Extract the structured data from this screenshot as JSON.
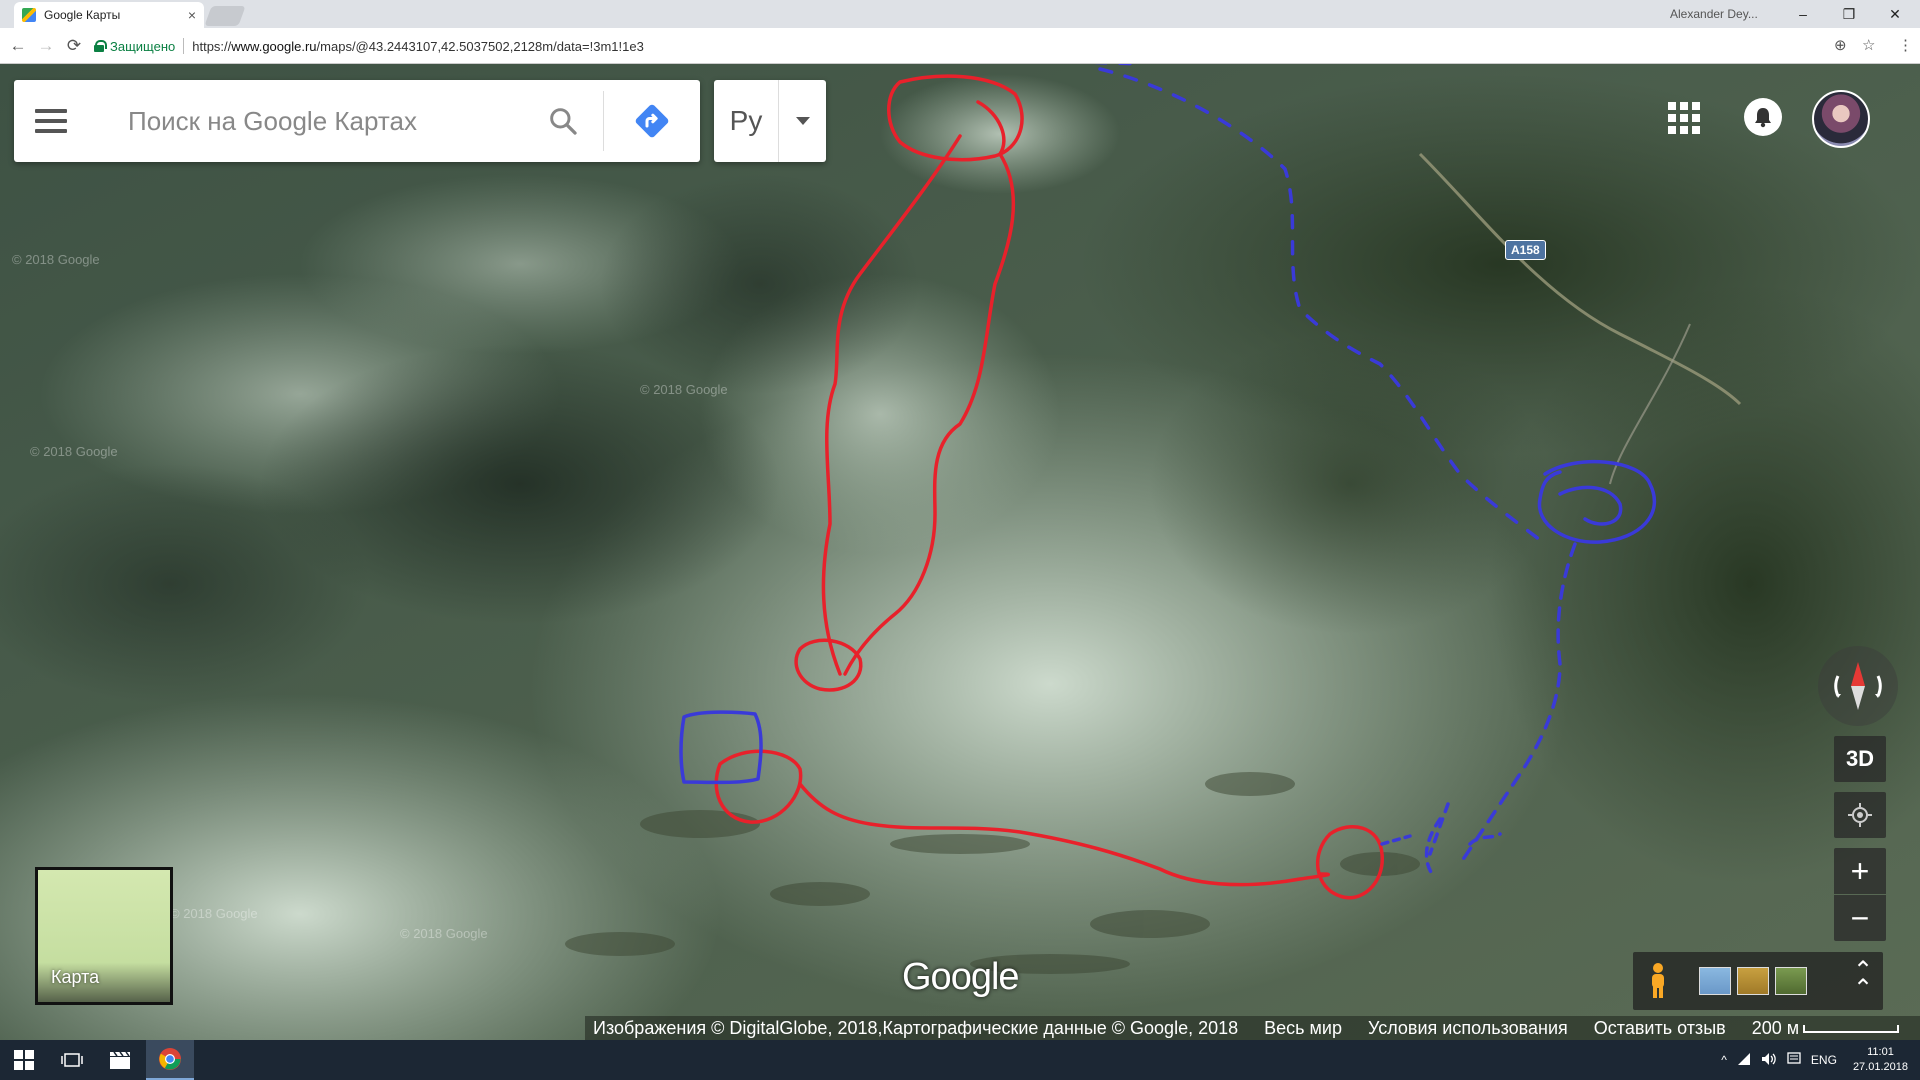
{
  "browser": {
    "tab_title": "Google Карты",
    "tab_close": "×",
    "profile_name": "Alexander Dey...",
    "window_min": "–",
    "window_max": "❐",
    "window_close": "✕",
    "back": "←",
    "forward": "→",
    "reload": "⟳",
    "secure_label": "Защищено",
    "url_scheme": "https://",
    "url_host": "www.google.ru",
    "url_path": "/maps/@43.2443107,42.5037502,2128m/data=!3m1!1e3",
    "zoom_icon": "⊕",
    "star_icon": "☆",
    "menu_icon": "⋮"
  },
  "search": {
    "placeholder": "Поиск на Google Картах"
  },
  "language": {
    "label": "Ру"
  },
  "map": {
    "road_label": "A158",
    "watermark": "© 2018 Google",
    "logo": "Google",
    "layer_label": "Карта",
    "btn_3d": "3D",
    "zoom_in": "+",
    "zoom_out": "−",
    "expand": "⌃"
  },
  "attribution": {
    "imagery": "Изображения © DigitalGlobe, 2018,Картографические данные © Google, 2018",
    "world": "Весь мир",
    "terms": "Условия использования",
    "feedback": "Оставить отзыв",
    "scale": "200 м"
  },
  "taskbar": {
    "lang": "ENG",
    "time": "11:01",
    "date": "27.01.2018",
    "tray_up": "^"
  },
  "colors": {
    "red_annotation": "#e8212b",
    "blue_annotation": "#3a3ad8",
    "directions_blue": "#4285f4"
  }
}
